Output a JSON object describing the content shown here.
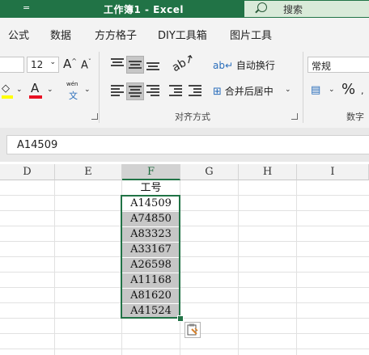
{
  "titlebar": {
    "qa_dropdown": "=",
    "title": "工作簿1 - Excel",
    "search_label": "搜索"
  },
  "tabs": [
    "公式",
    "数据",
    "方方格子",
    "DIY工具箱",
    "图片工具"
  ],
  "ribbon": {
    "font_size": "12",
    "grow_font": "A",
    "shrink_font": "A",
    "font_color_glyph": "A",
    "phonetic_top": "wén",
    "phonetic_bottom": "文",
    "wrap_text": "自动换行",
    "merge_center": "合并后居中",
    "alignment_group": "对齐方式",
    "number_format": "常规",
    "percent": "%",
    "number_group": "数字",
    "accent_green": "#217346",
    "font_color_red": "#e81123",
    "fill_yellow": "#ffff00"
  },
  "name_box": {
    "value": "A14509"
  },
  "columns": [
    "D",
    "E",
    "F",
    "G",
    "H",
    "I"
  ],
  "selected_column": "F",
  "cells": {
    "header": "工号",
    "ids": [
      "A14509",
      "A74850",
      "A83323",
      "A33167",
      "A26598",
      "A11168",
      "A81620",
      "A41524"
    ]
  }
}
